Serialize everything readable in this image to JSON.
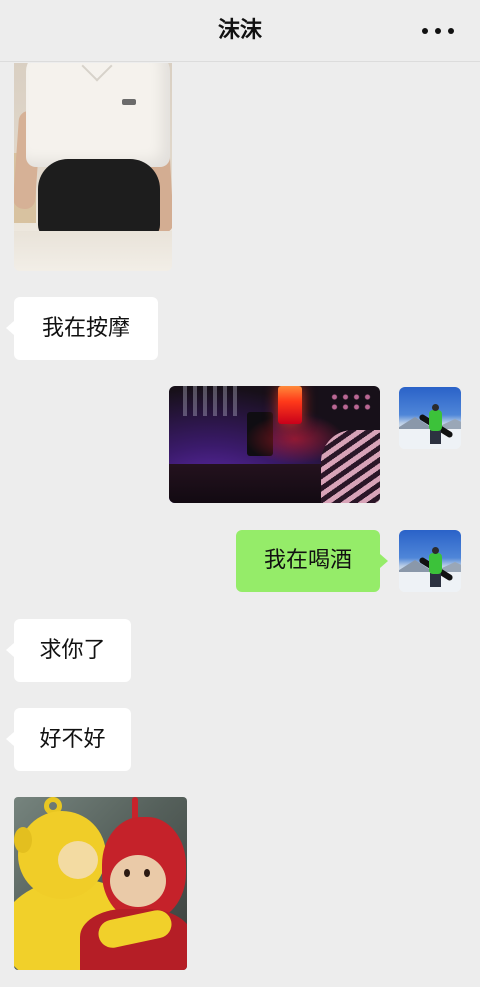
{
  "header": {
    "title": "沫沫",
    "more_icon": "more-icon"
  },
  "chat": {
    "messages": [
      {
        "text": "我在按摩"
      },
      {
        "text": "我在喝酒"
      },
      {
        "text": "求你了"
      },
      {
        "text": "好不好"
      }
    ]
  },
  "colors": {
    "background": "#ededed",
    "bubble_received": "#ffffff",
    "bubble_sent": "#95ec69"
  }
}
